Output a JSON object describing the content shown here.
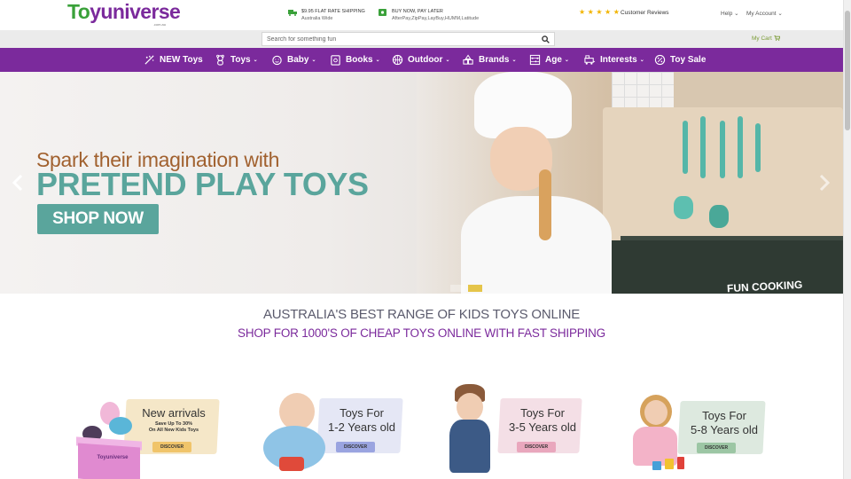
{
  "brand": {
    "name_part1": "To",
    "name_part2": "yuniverse",
    "domain_sub": ".com.au"
  },
  "promos": [
    {
      "icon": "truck-icon",
      "line1": "$9.95 FLAT RATE SHIPPING",
      "line2": "Australia Wide"
    },
    {
      "icon": "money-icon",
      "line1": "BUY NOW, PAY LATER",
      "line2": "AfterPay,ZipPay,LayBuy,HUMM,Latitude"
    }
  ],
  "reviews": {
    "stars": "★★★★★",
    "label": "Customer Reviews"
  },
  "top_links": {
    "help": "Help ⌄",
    "account": "My Account ⌄"
  },
  "search": {
    "placeholder": "Search for something fun"
  },
  "cart": {
    "label": "My Cart"
  },
  "nav": [
    {
      "label": "NEW Toys",
      "icon": "sparkle-rocket-icon",
      "has_caret": false
    },
    {
      "label": "Toys",
      "icon": "teddy-icon",
      "has_caret": true
    },
    {
      "label": "Baby",
      "icon": "baby-icon",
      "has_caret": true
    },
    {
      "label": "Books",
      "icon": "book-icon",
      "has_caret": true
    },
    {
      "label": "Outdoor",
      "icon": "ball-icon",
      "has_caret": true
    },
    {
      "label": "Brands",
      "icon": "blocks-icon",
      "has_caret": true
    },
    {
      "label": "Age",
      "icon": "abacus-icon",
      "has_caret": true
    },
    {
      "label": "Interests",
      "icon": "train-icon",
      "has_caret": true
    },
    {
      "label": "Toy Sale",
      "icon": "sale-tag-icon",
      "has_caret": false
    }
  ],
  "nav_caret": "⌄",
  "hero": {
    "line1": "Spark their imagination with",
    "line2": "PRETEND PLAY TOYS",
    "button": "SHOP NOW",
    "badge": "FUN COOKING"
  },
  "headings": {
    "main": "AUSTRALIA'S BEST RANGE OF KIDS TOYS ONLINE",
    "sub": "SHOP FOR 1000'S OF CHEAP TOYS ONLINE WITH FAST SHIPPING"
  },
  "categories": [
    {
      "title": "New arrivals",
      "promo1": "Save Up To 30%",
      "promo2": "On All New Kids Toys",
      "button": "DISCOVER",
      "box_brand": "Toyuniverse"
    },
    {
      "title1": "Toys For",
      "title2": "1-2 Years old",
      "button": "DISCOVER"
    },
    {
      "title1": "Toys For",
      "title2": "3-5 Years old",
      "button": "DISCOVER"
    },
    {
      "title1": "Toys For",
      "title2": "5-8 Years old",
      "button": "DISCOVER"
    }
  ],
  "colors": {
    "purple": "#7b2a9c",
    "green": "#3aa13a",
    "teal": "#5aa59c",
    "hero_orange": "#a1612f",
    "star": "#f2b400"
  }
}
